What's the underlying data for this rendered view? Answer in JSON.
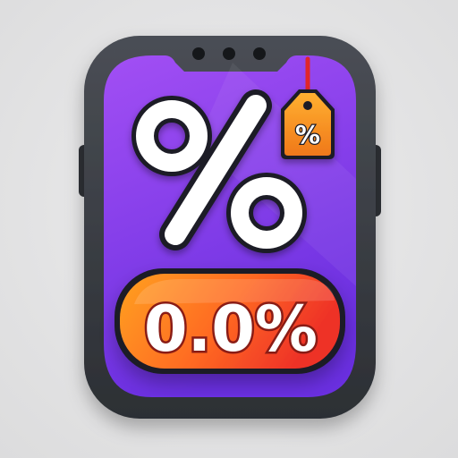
{
  "icon": {
    "name": "discount-percentage-app-icon",
    "big_symbol": "%",
    "tag_symbol": "%",
    "badge_value": "0.0%"
  },
  "colors": {
    "background": "#e3e3e4",
    "frame": "#3a3d42",
    "screen_top": "#9b4cf2",
    "screen_bottom": "#6a2fe0",
    "badge_left": "#ff9a1f",
    "badge_right": "#f23d2a",
    "tag": "#f79a1c",
    "symbol": "#ffffff"
  }
}
